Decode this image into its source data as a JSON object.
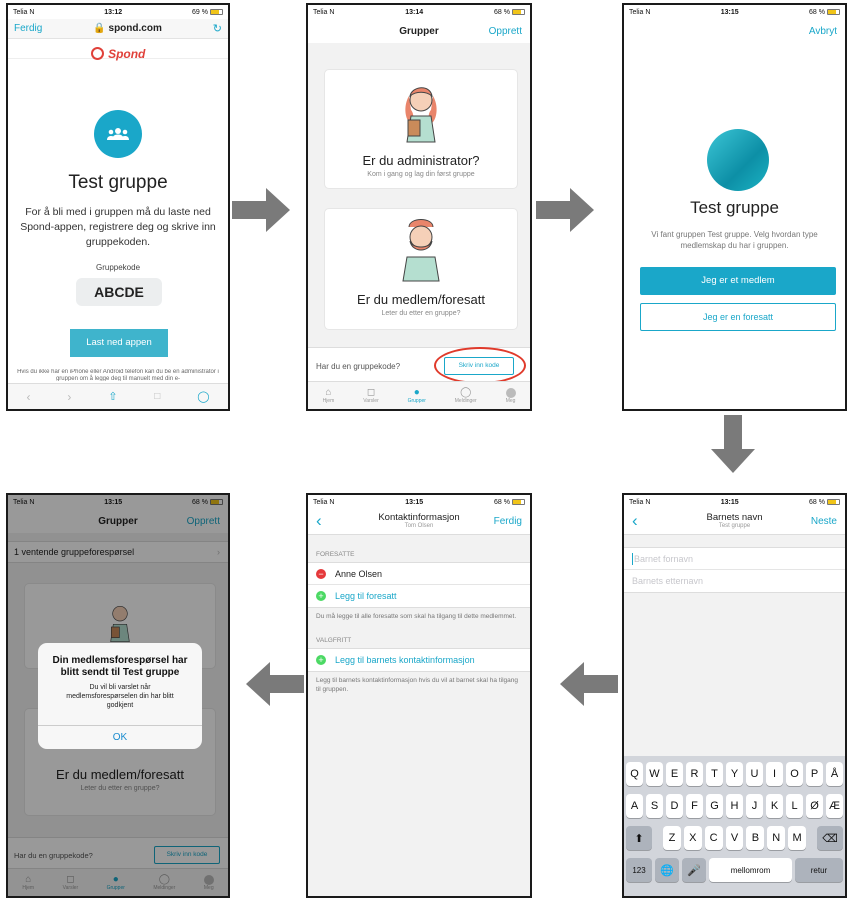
{
  "status": {
    "carrier": "Telia N",
    "s1": {
      "time": "13:12",
      "battery": "69 %"
    },
    "s2": {
      "time": "13:14",
      "battery": "68 %"
    },
    "s3": {
      "time": "13:15",
      "battery": "68 %"
    },
    "s4": {
      "time": "13:15",
      "battery": "68 %"
    },
    "s5": {
      "time": "13:15",
      "battery": "68 %"
    },
    "s6": {
      "time": "13:15",
      "battery": "68 %"
    }
  },
  "screen1": {
    "done": "Ferdig",
    "url": "spond.com",
    "logo": "Spond",
    "group_title": "Test gruppe",
    "description": "For å bli med i gruppen må du laste ned Spond-appen, registrere deg og skrive inn gruppekoden.",
    "code_label": "Gruppekode",
    "code": "ABCDE",
    "download_button": "Last ned appen",
    "footer": "Hvis du ikke har en iPhone eller Android telefon kan du be en administrator i gruppen om å legge deg til manuelt med din e-"
  },
  "screen2": {
    "title": "Grupper",
    "create": "Opprett",
    "admin_title": "Er du administrator?",
    "admin_sub": "Kom i gang og lag din først gruppe",
    "member_title": "Er du medlem/foresatt",
    "member_sub": "Leter du etter en gruppe?",
    "code_prompt": "Har du en gruppekode?",
    "code_button": "Skriv inn kode"
  },
  "tabs": [
    "Hjem",
    "Varsler",
    "Grupper",
    "Meldinger",
    "Meg"
  ],
  "screen3": {
    "cancel": "Avbryt",
    "group_title": "Test gruppe",
    "description": "Vi fant gruppen Test gruppe. Velg hvordan type medlemskap du har i gruppen.",
    "member_button": "Jeg er et medlem",
    "guardian_button": "Jeg er en foresatt"
  },
  "screen4": {
    "title": "Grupper",
    "create": "Opprett",
    "pending": "1 ventende gruppeforespørsel",
    "dialog_title": "Din medlemsforespørsel har blitt sendt til Test gruppe",
    "dialog_body": "Du vil bli varslet når medlemsforespørselen din har blitt godkjent",
    "ok": "OK",
    "member_title": "Er du medlem/foresatt",
    "member_sub": "Leter du etter en gruppe?",
    "code_prompt": "Har du en gruppekode?",
    "code_button": "Skriv inn kode"
  },
  "screen5": {
    "title": "Kontaktinformasjon",
    "subtitle": "Tom Olsen",
    "done": "Ferdig",
    "section_guardians": "FORESATTE",
    "guardian_name": "Anne Olsen",
    "add_guardian": "Legg til foresatt",
    "guardian_note": "Du må legge til alle foresatte som skal ha tilgang til dette medlemmet.",
    "section_optional": "VALGFRITT",
    "add_contact": "Legg til barnets kontaktinformasjon",
    "contact_note": "Legg til barnets kontaktinformasjon hvis du vil at barnet skal ha tilgang til gruppen."
  },
  "screen6": {
    "title": "Barnets navn",
    "subtitle": "Test gruppe",
    "next": "Neste",
    "first_placeholder": "Barnet fornavn",
    "last_placeholder": "Barnets etternavn",
    "row1": [
      "Q",
      "W",
      "E",
      "R",
      "T",
      "Y",
      "U",
      "I",
      "O",
      "P",
      "Å"
    ],
    "row2": [
      "A",
      "S",
      "D",
      "F",
      "G",
      "H",
      "J",
      "K",
      "L",
      "Ø",
      "Æ"
    ],
    "row3": [
      "Z",
      "X",
      "C",
      "V",
      "B",
      "N",
      "M"
    ],
    "numbers": "123",
    "space": "mellomrom",
    "return": "retur"
  },
  "colors": {
    "accent": "#1aa7c9",
    "highlight": "#e03a2b",
    "remove": "#e5393b",
    "add": "#4cd964",
    "arrow": "#7a7a7a"
  }
}
